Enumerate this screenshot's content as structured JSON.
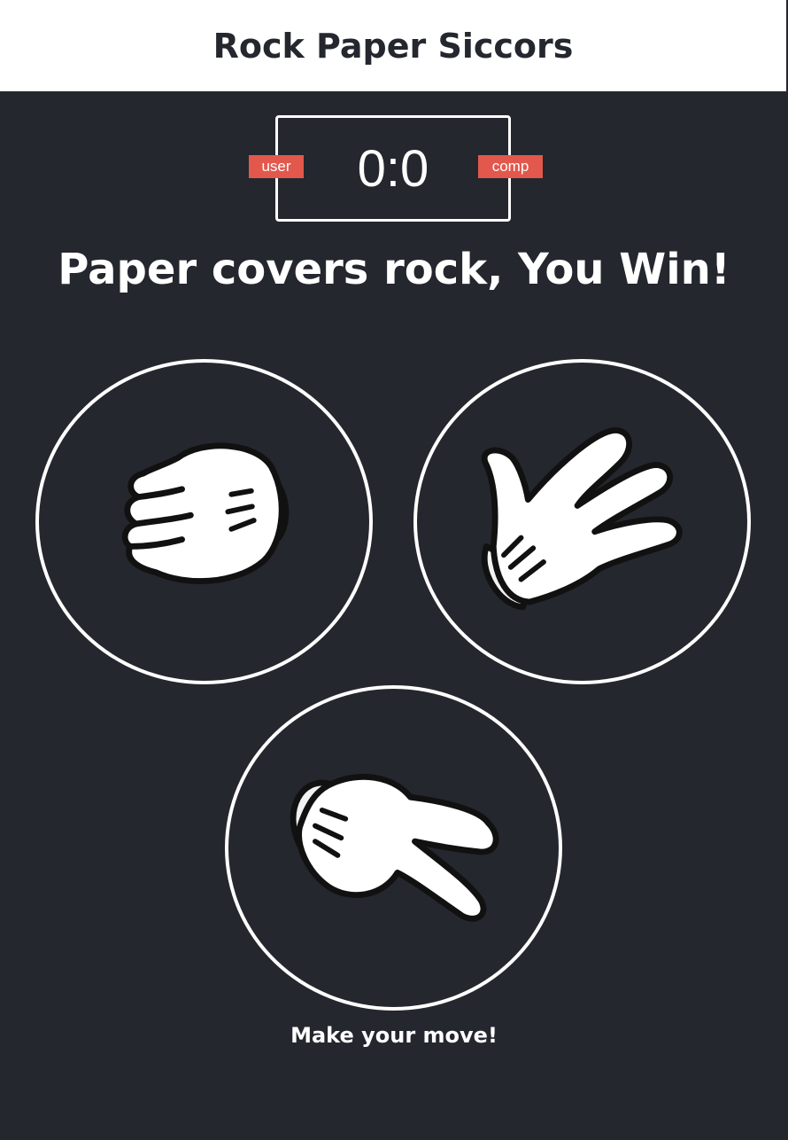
{
  "header": {
    "title": "Rock Paper Siccors"
  },
  "scoreboard": {
    "score": "0:0",
    "user_label": "user",
    "comp_label": "comp"
  },
  "result_message": "Paper covers rock, You Win!",
  "choices": [
    {
      "name": "rock",
      "icon": "rock-fist-glove-icon"
    },
    {
      "name": "paper",
      "icon": "paper-open-hand-glove-icon"
    },
    {
      "name": "scissors",
      "icon": "scissors-two-finger-glove-icon"
    }
  ],
  "prompt": "Make your move!",
  "colors": {
    "background": "#24272e",
    "header_background": "#ffffff",
    "badge": "#e2584d",
    "foreground": "#ffffff"
  }
}
